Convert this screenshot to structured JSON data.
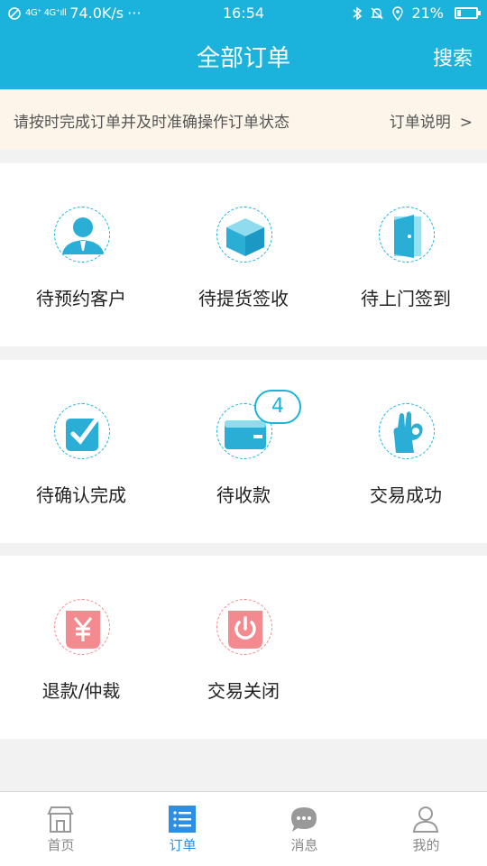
{
  "status_bar": {
    "signal_text": "4G⁺ 4G⁺ıll",
    "speed": "74.0K/s",
    "dots": "···",
    "time": "16:54",
    "battery": "21%",
    "battery_level": 0.21
  },
  "header": {
    "title": "全部订单",
    "search_label": "搜索"
  },
  "notice": {
    "text": "请按时完成订单并及时准确操作订单状态",
    "link_label": "订单说明",
    "link_chevron": ">"
  },
  "order_groups": [
    {
      "items": [
        {
          "label": "待预约客户",
          "icon": "customer-icon"
        },
        {
          "label": "待提货签收",
          "icon": "package-icon"
        },
        {
          "label": "待上门签到",
          "icon": "door-icon"
        }
      ]
    },
    {
      "items": [
        {
          "label": "待确认完成",
          "icon": "check-icon"
        },
        {
          "label": "待收款",
          "icon": "wallet-icon",
          "badge": "4"
        },
        {
          "label": "交易成功",
          "icon": "ok-hand-icon"
        }
      ]
    },
    {
      "items": [
        {
          "label": "退款/仲裁",
          "icon": "yen-icon"
        },
        {
          "label": "交易关闭",
          "icon": "power-icon"
        }
      ]
    }
  ],
  "tabbar": {
    "active": "订单",
    "tabs": [
      {
        "label": "首页",
        "icon": "store-icon"
      },
      {
        "label": "订单",
        "icon": "list-icon"
      },
      {
        "label": "消息",
        "icon": "chat-icon"
      },
      {
        "label": "我的",
        "icon": "user-icon"
      }
    ]
  },
  "colors": {
    "primary": "#1bb3dc",
    "notice_bg": "#fdf5ea",
    "danger": "#f28a8f",
    "tab_active": "#2c8fe3"
  }
}
